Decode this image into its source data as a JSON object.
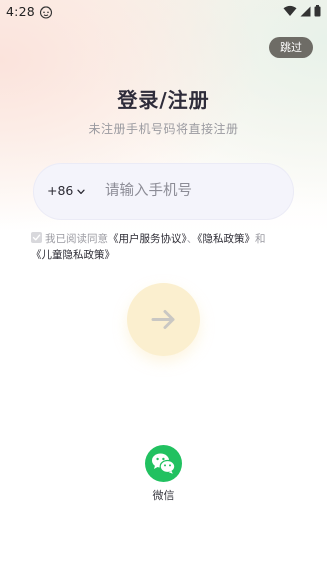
{
  "status_bar": {
    "time": "4:28",
    "icons": [
      "face-emoji-icon",
      "wifi-icon",
      "cellular-signal-icon",
      "battery-icon"
    ]
  },
  "skip_label": "跳过",
  "title": "登录/注册",
  "subtitle": "未注册手机号码将直接注册",
  "phone": {
    "country_code": "+86",
    "placeholder": "请输入手机号",
    "value": ""
  },
  "agreement": {
    "checked": true,
    "prefix": "我已阅读同意",
    "user_agreement": "《用户服务协议》",
    "separator": "、",
    "privacy_policy": "《隐私政策》",
    "and": "和",
    "children_privacy": "《儿童隐私政策》"
  },
  "next_button": {
    "icon": "arrow-right-icon"
  },
  "wechat": {
    "label": "微信",
    "icon": "wechat-icon"
  },
  "colors": {
    "skip_bg": "#6e6c66",
    "input_bg": "#f4f4fb",
    "next_bg": "#fbefcf",
    "wechat_green": "#21c160"
  }
}
